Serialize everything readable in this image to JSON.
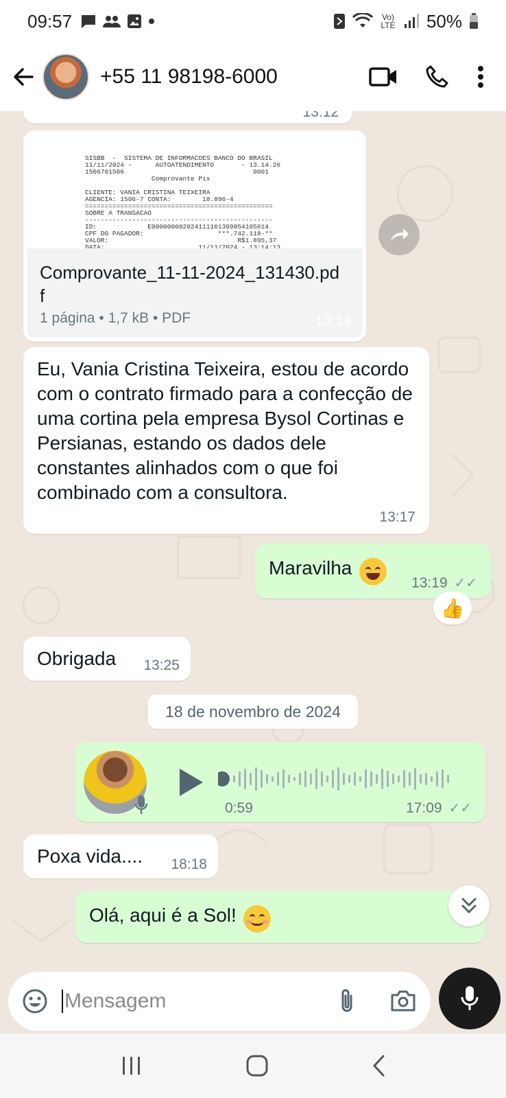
{
  "status_bar": {
    "time": "09:57",
    "left_icons": [
      "chat-bubble-icon",
      "group-icon",
      "image-icon",
      "dot-icon"
    ],
    "right_icons": [
      "nfc-icon",
      "wifi-icon",
      "volte-icon",
      "signal-icon",
      "battery-icon"
    ],
    "volte_label": "Vo) LTE",
    "battery_pct": "50%"
  },
  "header": {
    "contact_name": "+55 11 98198-6000",
    "actions": [
      "video-call-icon",
      "phone-icon",
      "more-icon"
    ]
  },
  "messages": {
    "top_partial": {
      "time": "13:12"
    },
    "document": {
      "preview_text": "SISBB  -  SISTEMA DE INFORMACOES BANCO DO BRASIL\n11/11/2024 -      AUTOATENDIMENTO       - 13.14.26\n1506701506                                 0001\n                 Comprovante Pix\n\nCLIENTE: VANIA CRISTINA TEIXEIRA\nAGENCIA: 1506-7 CONTA:        18.896-4\n================================================\nSOBRE A TRANSACAO\n------------------------------------------------\nID:             E000000002024111161309854105614\nCPF DO PAGADOR:                   ***.742.118-**\nVALOR:                                 R$1.895,37\nDATA:                        11/11/2024 - 13:14:13",
      "file_name": "Comprovante_11-11-2024_131430.pdf",
      "meta": "1 página • 1,7 kB • PDF",
      "time": "13:14"
    },
    "long_text": {
      "text": "Eu, Vania Cristina Teixeira,  estou de acordo com o contrato firmado para a confecção de uma cortina pela empresa Bysol Cortinas e Persianas,  estando os dados dele constantes alinhados com o que foi combinado com a consultora.",
      "time": "13:17"
    },
    "maravilha": {
      "text": "Maravilha",
      "emoji": "grinning-face-icon",
      "time": "13:19",
      "reaction": "👍"
    },
    "obrigada": {
      "text": "Obrigada",
      "time": "13:25"
    },
    "date_divider": "18 de novembro de 2024",
    "voice_note": {
      "duration": "0:59",
      "time": "17:09"
    },
    "poxa": {
      "text": "Poxa vida....",
      "time": "18:18"
    },
    "sol": {
      "text": "Olá, aqui é a Sol!",
      "emoji": "smiling-face-icon"
    }
  },
  "input": {
    "placeholder": "Mensagem"
  },
  "colors": {
    "incoming_bubble": "#ffffff",
    "outgoing_bubble": "#d9fdd3",
    "chat_background": "#efe7de",
    "mic_button": "#1b1b1b"
  }
}
